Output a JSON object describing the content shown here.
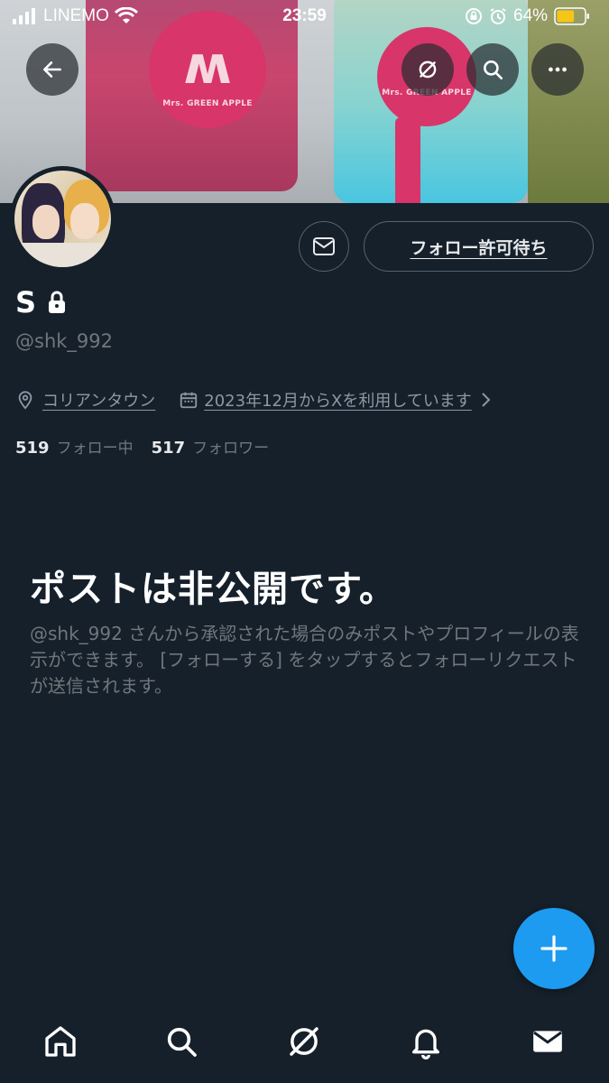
{
  "status_bar": {
    "carrier": "LINEMO",
    "time": "23:59",
    "battery_percent": "64%",
    "battery_level": 0.64
  },
  "banner": {
    "logo_text": "Mrs. GREEN APPLE",
    "colors": {
      "pink_cup": "#c9466e",
      "blue_cup": "#49c6e0",
      "logo": "#d8356a"
    }
  },
  "profile": {
    "display_name": "S",
    "handle": "@shk_992",
    "location": "コリアンタウン",
    "joined": "2023年12月からXを利用しています",
    "following_count": "519",
    "following_label": "フォロー中",
    "followers_count": "517",
    "followers_label": "フォロワー"
  },
  "actions": {
    "follow_label": "フォロー許可待ち"
  },
  "private_notice": {
    "title": "ポストは非公開です。",
    "description": "@shk_992 さんから承認された場合のみポストやプロフィールの表示ができます。 [フォローする] をタップするとフォローリクエストが送信されます。"
  },
  "icons": {
    "back": "arrow-left-icon",
    "grok": "grok-icon",
    "search": "search-icon",
    "more": "more-icon",
    "lock": "lock-icon",
    "message": "envelope-icon",
    "location": "location-pin-icon",
    "calendar": "calendar-icon",
    "compose": "plus-icon",
    "tabs": [
      "home-icon",
      "search-icon",
      "grok-icon",
      "bell-icon",
      "envelope-icon"
    ]
  },
  "theme": {
    "background": "#15202b",
    "accent": "#1d9bf0",
    "muted": "#71767b"
  }
}
